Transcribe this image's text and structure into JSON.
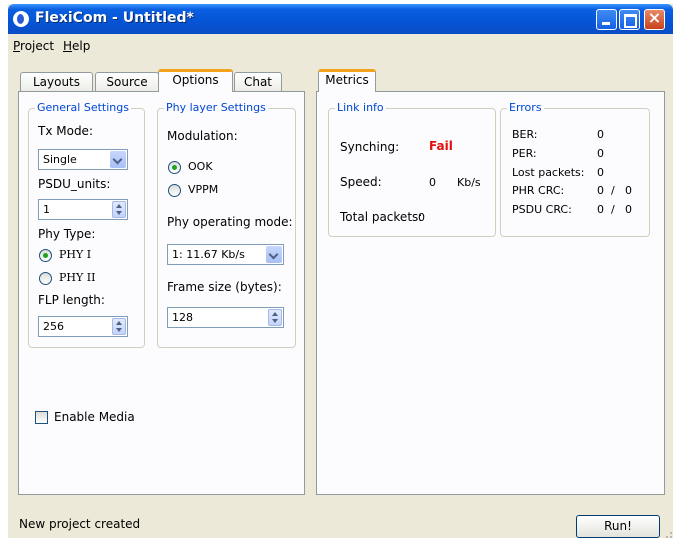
{
  "window": {
    "title": "FlexiCom - Untitled*"
  },
  "menu": [
    {
      "accel": "P",
      "rest": "roject"
    },
    {
      "accel": "H",
      "rest": "elp"
    }
  ],
  "left_tabs": [
    "Layouts",
    "Source",
    "Options",
    "Chat"
  ],
  "left_active_tab": "Options",
  "right_tabs": [
    "Metrics"
  ],
  "general": {
    "title": "General Settings",
    "tx_mode_label": "Tx Mode:",
    "tx_mode_value": "Single",
    "psdu_units_label": "PSDU_units:",
    "psdu_units_value": "1",
    "phy_type_label": "Phy Type:",
    "phy1": "PHY I",
    "phy2": "PHY II",
    "phy_selected": "PHY I",
    "flp_label": "FLP length:",
    "flp_value": "256",
    "enable_media": "Enable Media",
    "enable_media_checked": false
  },
  "phy": {
    "title": "Phy layer Settings",
    "modulation_label": "Modulation:",
    "ook": "OOK",
    "vppm": "VPPM",
    "modulation_selected": "OOK",
    "op_mode_label": "Phy operating mode:",
    "op_mode_value": "1: 11.67 Kb/s",
    "frame_size_label": "Frame size (bytes):",
    "frame_size_value": "128"
  },
  "link_info": {
    "title": "Link info",
    "synching_label": "Synching:",
    "synching_value": "Fail",
    "speed_label": "Speed:",
    "speed_value": "0",
    "speed_unit": "Kb/s",
    "total_label": "Total packets:",
    "total_value": "0"
  },
  "errors": {
    "title": "Errors",
    "ber_label": "BER:",
    "ber_value": "0",
    "per_label": "PER:",
    "per_value": "0",
    "lost_label": "Lost packets:",
    "lost_value": "0",
    "phr_label": "PHR CRC:",
    "phr_a": "0",
    "phr_sep": "/",
    "phr_b": "0",
    "psdu_label": "PSDU CRC:",
    "psdu_a": "0",
    "psdu_sep": "/",
    "psdu_b": "0"
  },
  "status_text": "New project created",
  "run_label": "Run!",
  "colors": {
    "accent": "#0046d5",
    "fail": "#e0100c",
    "title_bar": "#0554d6",
    "tab_highlight": "#f2a31b"
  }
}
